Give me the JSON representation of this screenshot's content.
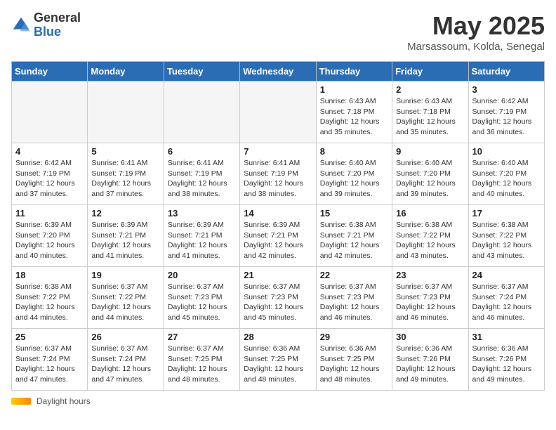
{
  "logo": {
    "general": "General",
    "blue": "Blue"
  },
  "title": "May 2025",
  "location": "Marsassoum, Kolda, Senegal",
  "days_of_week": [
    "Sunday",
    "Monday",
    "Tuesday",
    "Wednesday",
    "Thursday",
    "Friday",
    "Saturday"
  ],
  "footer": {
    "daylight_label": "Daylight hours"
  },
  "weeks": [
    [
      {
        "day": "",
        "info": ""
      },
      {
        "day": "",
        "info": ""
      },
      {
        "day": "",
        "info": ""
      },
      {
        "day": "",
        "info": ""
      },
      {
        "day": "1",
        "info": "Sunrise: 6:43 AM\nSunset: 7:18 PM\nDaylight: 12 hours\nand 35 minutes."
      },
      {
        "day": "2",
        "info": "Sunrise: 6:43 AM\nSunset: 7:18 PM\nDaylight: 12 hours\nand 35 minutes."
      },
      {
        "day": "3",
        "info": "Sunrise: 6:42 AM\nSunset: 7:19 PM\nDaylight: 12 hours\nand 36 minutes."
      }
    ],
    [
      {
        "day": "4",
        "info": "Sunrise: 6:42 AM\nSunset: 7:19 PM\nDaylight: 12 hours\nand 37 minutes."
      },
      {
        "day": "5",
        "info": "Sunrise: 6:41 AM\nSunset: 7:19 PM\nDaylight: 12 hours\nand 37 minutes."
      },
      {
        "day": "6",
        "info": "Sunrise: 6:41 AM\nSunset: 7:19 PM\nDaylight: 12 hours\nand 38 minutes."
      },
      {
        "day": "7",
        "info": "Sunrise: 6:41 AM\nSunset: 7:19 PM\nDaylight: 12 hours\nand 38 minutes."
      },
      {
        "day": "8",
        "info": "Sunrise: 6:40 AM\nSunset: 7:20 PM\nDaylight: 12 hours\nand 39 minutes."
      },
      {
        "day": "9",
        "info": "Sunrise: 6:40 AM\nSunset: 7:20 PM\nDaylight: 12 hours\nand 39 minutes."
      },
      {
        "day": "10",
        "info": "Sunrise: 6:40 AM\nSunset: 7:20 PM\nDaylight: 12 hours\nand 40 minutes."
      }
    ],
    [
      {
        "day": "11",
        "info": "Sunrise: 6:39 AM\nSunset: 7:20 PM\nDaylight: 12 hours\nand 40 minutes."
      },
      {
        "day": "12",
        "info": "Sunrise: 6:39 AM\nSunset: 7:21 PM\nDaylight: 12 hours\nand 41 minutes."
      },
      {
        "day": "13",
        "info": "Sunrise: 6:39 AM\nSunset: 7:21 PM\nDaylight: 12 hours\nand 41 minutes."
      },
      {
        "day": "14",
        "info": "Sunrise: 6:39 AM\nSunset: 7:21 PM\nDaylight: 12 hours\nand 42 minutes."
      },
      {
        "day": "15",
        "info": "Sunrise: 6:38 AM\nSunset: 7:21 PM\nDaylight: 12 hours\nand 42 minutes."
      },
      {
        "day": "16",
        "info": "Sunrise: 6:38 AM\nSunset: 7:22 PM\nDaylight: 12 hours\nand 43 minutes."
      },
      {
        "day": "17",
        "info": "Sunrise: 6:38 AM\nSunset: 7:22 PM\nDaylight: 12 hours\nand 43 minutes."
      }
    ],
    [
      {
        "day": "18",
        "info": "Sunrise: 6:38 AM\nSunset: 7:22 PM\nDaylight: 12 hours\nand 44 minutes."
      },
      {
        "day": "19",
        "info": "Sunrise: 6:37 AM\nSunset: 7:22 PM\nDaylight: 12 hours\nand 44 minutes."
      },
      {
        "day": "20",
        "info": "Sunrise: 6:37 AM\nSunset: 7:23 PM\nDaylight: 12 hours\nand 45 minutes."
      },
      {
        "day": "21",
        "info": "Sunrise: 6:37 AM\nSunset: 7:23 PM\nDaylight: 12 hours\nand 45 minutes."
      },
      {
        "day": "22",
        "info": "Sunrise: 6:37 AM\nSunset: 7:23 PM\nDaylight: 12 hours\nand 46 minutes."
      },
      {
        "day": "23",
        "info": "Sunrise: 6:37 AM\nSunset: 7:23 PM\nDaylight: 12 hours\nand 46 minutes."
      },
      {
        "day": "24",
        "info": "Sunrise: 6:37 AM\nSunset: 7:24 PM\nDaylight: 12 hours\nand 46 minutes."
      }
    ],
    [
      {
        "day": "25",
        "info": "Sunrise: 6:37 AM\nSunset: 7:24 PM\nDaylight: 12 hours\nand 47 minutes."
      },
      {
        "day": "26",
        "info": "Sunrise: 6:37 AM\nSunset: 7:24 PM\nDaylight: 12 hours\nand 47 minutes."
      },
      {
        "day": "27",
        "info": "Sunrise: 6:37 AM\nSunset: 7:25 PM\nDaylight: 12 hours\nand 48 minutes."
      },
      {
        "day": "28",
        "info": "Sunrise: 6:36 AM\nSunset: 7:25 PM\nDaylight: 12 hours\nand 48 minutes."
      },
      {
        "day": "29",
        "info": "Sunrise: 6:36 AM\nSunset: 7:25 PM\nDaylight: 12 hours\nand 48 minutes."
      },
      {
        "day": "30",
        "info": "Sunrise: 6:36 AM\nSunset: 7:26 PM\nDaylight: 12 hours\nand 49 minutes."
      },
      {
        "day": "31",
        "info": "Sunrise: 6:36 AM\nSunset: 7:26 PM\nDaylight: 12 hours\nand 49 minutes."
      }
    ]
  ]
}
